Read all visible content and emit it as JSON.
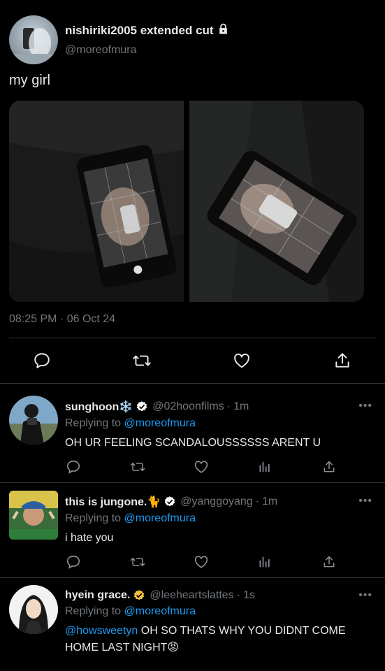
{
  "post": {
    "display_name": "nishiriki2005 extended cut",
    "handle": "@moreofmura",
    "text": "my girl",
    "timestamp": "08:25 PM · 06 Oct 24"
  },
  "actions": {
    "reply_icon": "reply-icon",
    "retweet_icon": "retweet-icon",
    "like_icon": "heart-icon",
    "share_icon": "share-icon"
  },
  "replies": [
    {
      "name": "sunghoon❄️",
      "handle": "@02hoonfilms",
      "time": "1m",
      "replying_label": "Replying to",
      "replying_to": "@moreofmura",
      "text": "OH UR FEELING SCANDALOUSSSSSS ARENT U",
      "badge_color": "#ffffff"
    },
    {
      "name": "this is jungone.🐈",
      "handle": "@yanggoyang",
      "time": "1m",
      "replying_label": "Replying to",
      "replying_to": "@moreofmura",
      "text": "i hate you",
      "badge_color": "#ffffff"
    },
    {
      "name": "hyein grace.",
      "handle": "@leeheartslattes",
      "time": "1s",
      "replying_label": "Replying to",
      "replying_to": "@moreofmura",
      "mention": "@howsweetyn",
      "text": "OH SO THATS WHY YOU DIDNT COME HOME LAST NIGHT😡",
      "badge_color": "#f4c13d"
    }
  ],
  "more_label": "•••",
  "colors": {
    "background": "#000000",
    "text": "#e7e9ea",
    "secondary": "#71767b",
    "link": "#1d9bf0",
    "divider": "#2f3336"
  }
}
